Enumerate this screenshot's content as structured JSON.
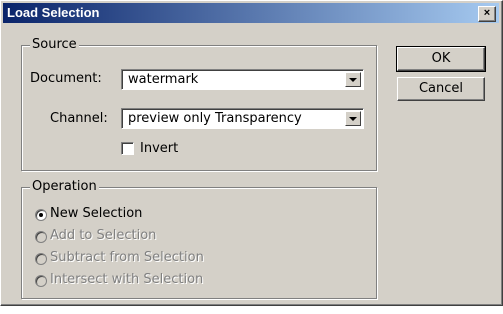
{
  "window": {
    "title": "Load Selection",
    "close_glyph": "×"
  },
  "source": {
    "legend": "Source",
    "document_label": "Document:",
    "document_value": "watermark",
    "channel_label": "Channel:",
    "channel_value": "preview only Transparency",
    "invert_label": "Invert",
    "invert_checked": false
  },
  "operation": {
    "legend": "Operation",
    "options": [
      {
        "label": "New Selection",
        "selected": true,
        "enabled": true
      },
      {
        "label": "Add to Selection",
        "selected": false,
        "enabled": false
      },
      {
        "label": "Subtract from Selection",
        "selected": false,
        "enabled": false
      },
      {
        "label": "Intersect with Selection",
        "selected": false,
        "enabled": false
      }
    ]
  },
  "buttons": {
    "ok": "OK",
    "cancel": "Cancel"
  },
  "colors": {
    "face": "#d4d0c8",
    "title_start": "#0a246a",
    "title_end": "#a6caf0",
    "disabled_text": "#808080"
  }
}
